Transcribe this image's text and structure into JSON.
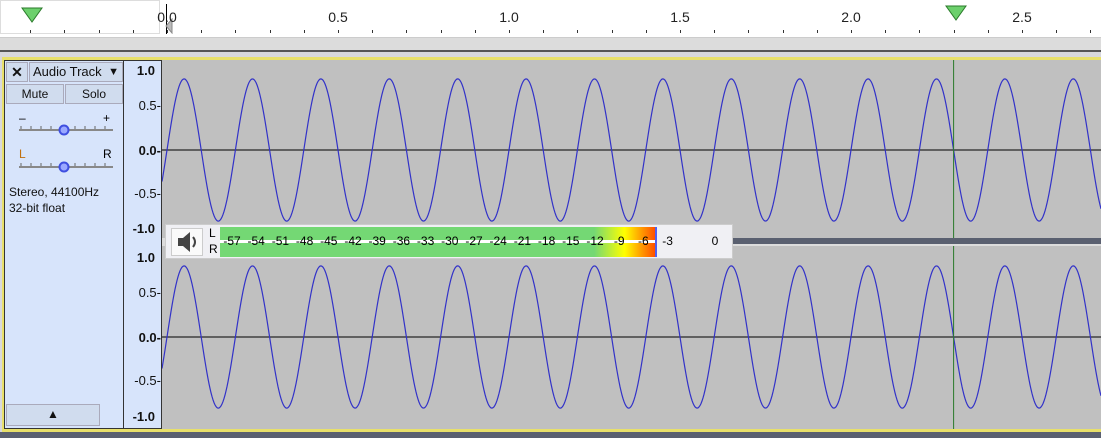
{
  "ruler": {
    "labels": [
      "0.0",
      "0.5",
      "1.0",
      "1.5",
      "2.0",
      "2.5"
    ],
    "seconds": [
      0,
      0.5,
      1.0,
      1.5,
      2.0,
      2.5
    ],
    "cursor_seconds": 2.3
  },
  "track": {
    "close_label": "✕",
    "name": "Audio Track",
    "mute_label": "Mute",
    "solo_label": "Solo",
    "gain_minus": "–",
    "gain_plus": "+",
    "pan_left": "L",
    "pan_right": "R",
    "gain_value": 0.5,
    "pan_value": 0.5,
    "format_line1": "Stereo, 44100Hz",
    "format_line2": "32-bit float",
    "collapse_icon": "triangle-up-icon"
  },
  "vruler": {
    "labels": [
      "1.0",
      "0.5-",
      "0.0-",
      "-0.5-",
      "-1.0"
    ]
  },
  "waveform": {
    "frequency_hz": 5,
    "amplitude": 0.9,
    "color": "#3232c8",
    "background": "#c0c0c0"
  },
  "meter": {
    "icon": "speaker-icon",
    "channels": [
      "L",
      "R"
    ],
    "ticks": [
      "-57",
      "-54",
      "-51",
      "-48",
      "-45",
      "-42",
      "-39",
      "-36",
      "-33",
      "-30",
      "-27",
      "-24",
      "-21",
      "-18",
      "-15",
      "-12",
      "-9",
      "-6",
      "-3",
      "0"
    ]
  }
}
